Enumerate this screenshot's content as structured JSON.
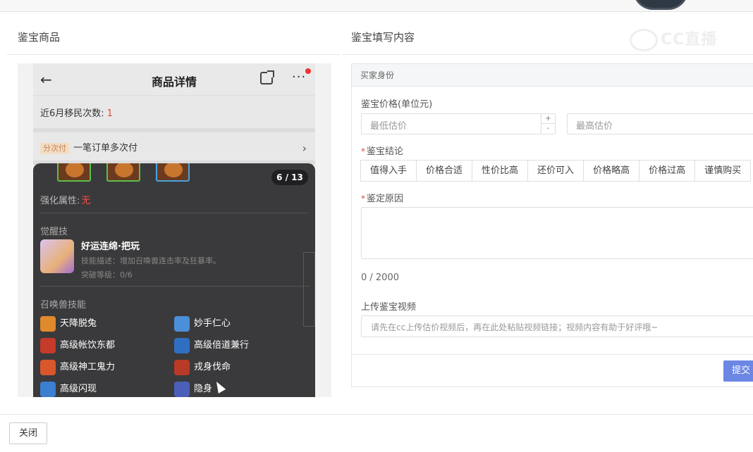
{
  "left_title": "鉴宝商品",
  "right_title": "鉴宝填写内容",
  "watermark": "CC直播",
  "phone": {
    "back_icon": "←",
    "title": "商品详情",
    "more_icon": "···",
    "migrate_label": "近6月移民次数:",
    "migrate_value": "1",
    "pay_tag": "分次付",
    "pay_text": "一笔订单多次付",
    "pay_arrow": "›",
    "page_badge": "6 / 13",
    "enhance_label": "强化属性:",
    "enhance_value": "无",
    "awaken_heading": "觉醒技",
    "skill_name": "好运连绵·把玩",
    "skill_desc": "技能描述：增加召唤兽连击率及狂暴率。",
    "skill_level": "突破等级：0/6",
    "summon_heading": "召唤兽技能",
    "summon_skills": [
      "天降脱兔",
      "妙手仁心",
      "高级帐饮东都",
      "高级倍道兼行",
      "高级神工鬼力",
      "戎身伐命",
      "高级闪现",
      "隐身"
    ]
  },
  "form": {
    "section_head": "买家身份",
    "price_label": "鉴宝价格(单位元)",
    "min_placeholder": "最低估价",
    "max_placeholder": "最高估价",
    "spin_up": "+",
    "spin_down": "-",
    "conclusion_label": "鉴宝结论",
    "conclusions": [
      "值得入手",
      "价格合适",
      "性价比高",
      "还价可入",
      "价格略高",
      "价格过高",
      "谨慎购买"
    ],
    "reason_label": "鉴定原因",
    "counter": "0 / 2000",
    "video_label": "上传鉴宝视频",
    "video_placeholder": "请先在cc上传估价视频后，再在此处粘贴视频链接；视频内容有助于好评哦~",
    "submit": "提交"
  },
  "close_button": "关闭",
  "colors": {
    "accent": "#6c86e3",
    "required": "#e04a3f",
    "dark_panel": "#3a3a3c"
  }
}
